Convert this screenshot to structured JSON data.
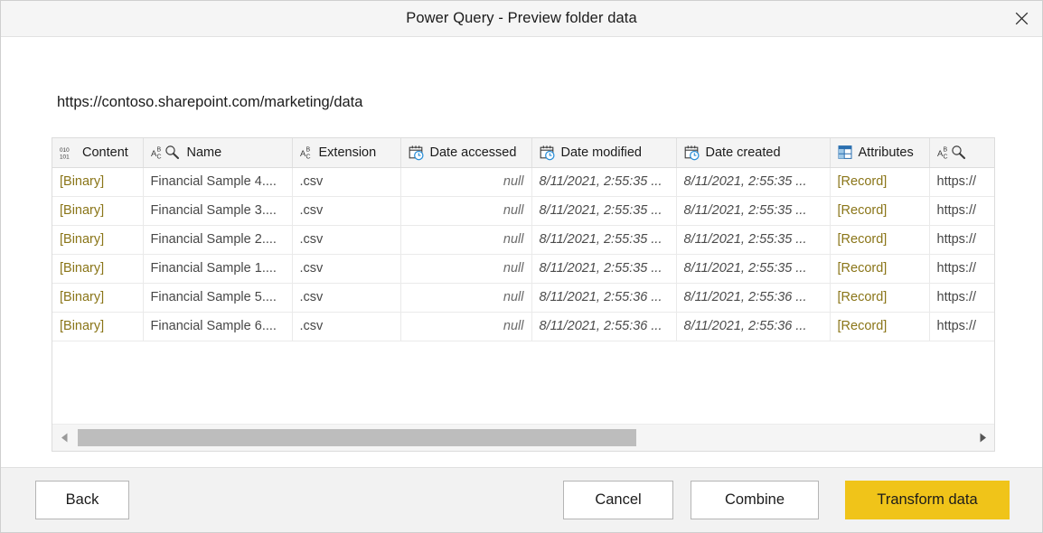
{
  "window": {
    "title": "Power Query - Preview folder data",
    "close_icon": "close-icon"
  },
  "header": {
    "url": "https://contoso.sharepoint.com/marketing/data"
  },
  "table": {
    "columns": [
      {
        "label": "Content",
        "icon": "binary-icon"
      },
      {
        "label": "Name",
        "icon": "text-any-icon"
      },
      {
        "label": "Extension",
        "icon": "text-icon"
      },
      {
        "label": "Date accessed",
        "icon": "datetime-icon"
      },
      {
        "label": "Date modified",
        "icon": "datetime-icon"
      },
      {
        "label": "Date created",
        "icon": "datetime-icon"
      },
      {
        "label": "Attributes",
        "icon": "record-table-icon"
      },
      {
        "label": "",
        "icon": "text-any-icon"
      }
    ],
    "rows": [
      {
        "content": "[Binary]",
        "name": "Financial Sample 4....",
        "extension": ".csv",
        "date_accessed": "null",
        "date_modified": "8/11/2021, 2:55:35 ...",
        "date_created": "8/11/2021, 2:55:35 ...",
        "attributes": "[Record]",
        "folder_path": "https://"
      },
      {
        "content": "[Binary]",
        "name": "Financial Sample 3....",
        "extension": ".csv",
        "date_accessed": "null",
        "date_modified": "8/11/2021, 2:55:35 ...",
        "date_created": "8/11/2021, 2:55:35 ...",
        "attributes": "[Record]",
        "folder_path": "https://"
      },
      {
        "content": "[Binary]",
        "name": "Financial Sample 2....",
        "extension": ".csv",
        "date_accessed": "null",
        "date_modified": "8/11/2021, 2:55:35 ...",
        "date_created": "8/11/2021, 2:55:35 ...",
        "attributes": "[Record]",
        "folder_path": "https://"
      },
      {
        "content": "[Binary]",
        "name": "Financial Sample 1....",
        "extension": ".csv",
        "date_accessed": "null",
        "date_modified": "8/11/2021, 2:55:35 ...",
        "date_created": "8/11/2021, 2:55:35 ...",
        "attributes": "[Record]",
        "folder_path": "https://"
      },
      {
        "content": "[Binary]",
        "name": "Financial Sample 5....",
        "extension": ".csv",
        "date_accessed": "null",
        "date_modified": "8/11/2021, 2:55:36 ...",
        "date_created": "8/11/2021, 2:55:36 ...",
        "attributes": "[Record]",
        "folder_path": "https://"
      },
      {
        "content": "[Binary]",
        "name": "Financial Sample 6....",
        "extension": ".csv",
        "date_accessed": "null",
        "date_modified": "8/11/2021, 2:55:36 ...",
        "date_created": "8/11/2021, 2:55:36 ...",
        "attributes": "[Record]",
        "folder_path": "https://"
      }
    ]
  },
  "scrollbar": {
    "left_arrow_icon": "triangle-left-icon",
    "right_arrow_icon": "triangle-right-icon"
  },
  "footer": {
    "back_label": "Back",
    "cancel_label": "Cancel",
    "combine_label": "Combine",
    "transform_label": "Transform data"
  },
  "colors": {
    "accent": "#f0c419",
    "link": "#8a7518",
    "titlebar_bg": "#f5f5f5",
    "footer_bg": "#f2f2f2",
    "header_bg": "#f4f4f4"
  }
}
